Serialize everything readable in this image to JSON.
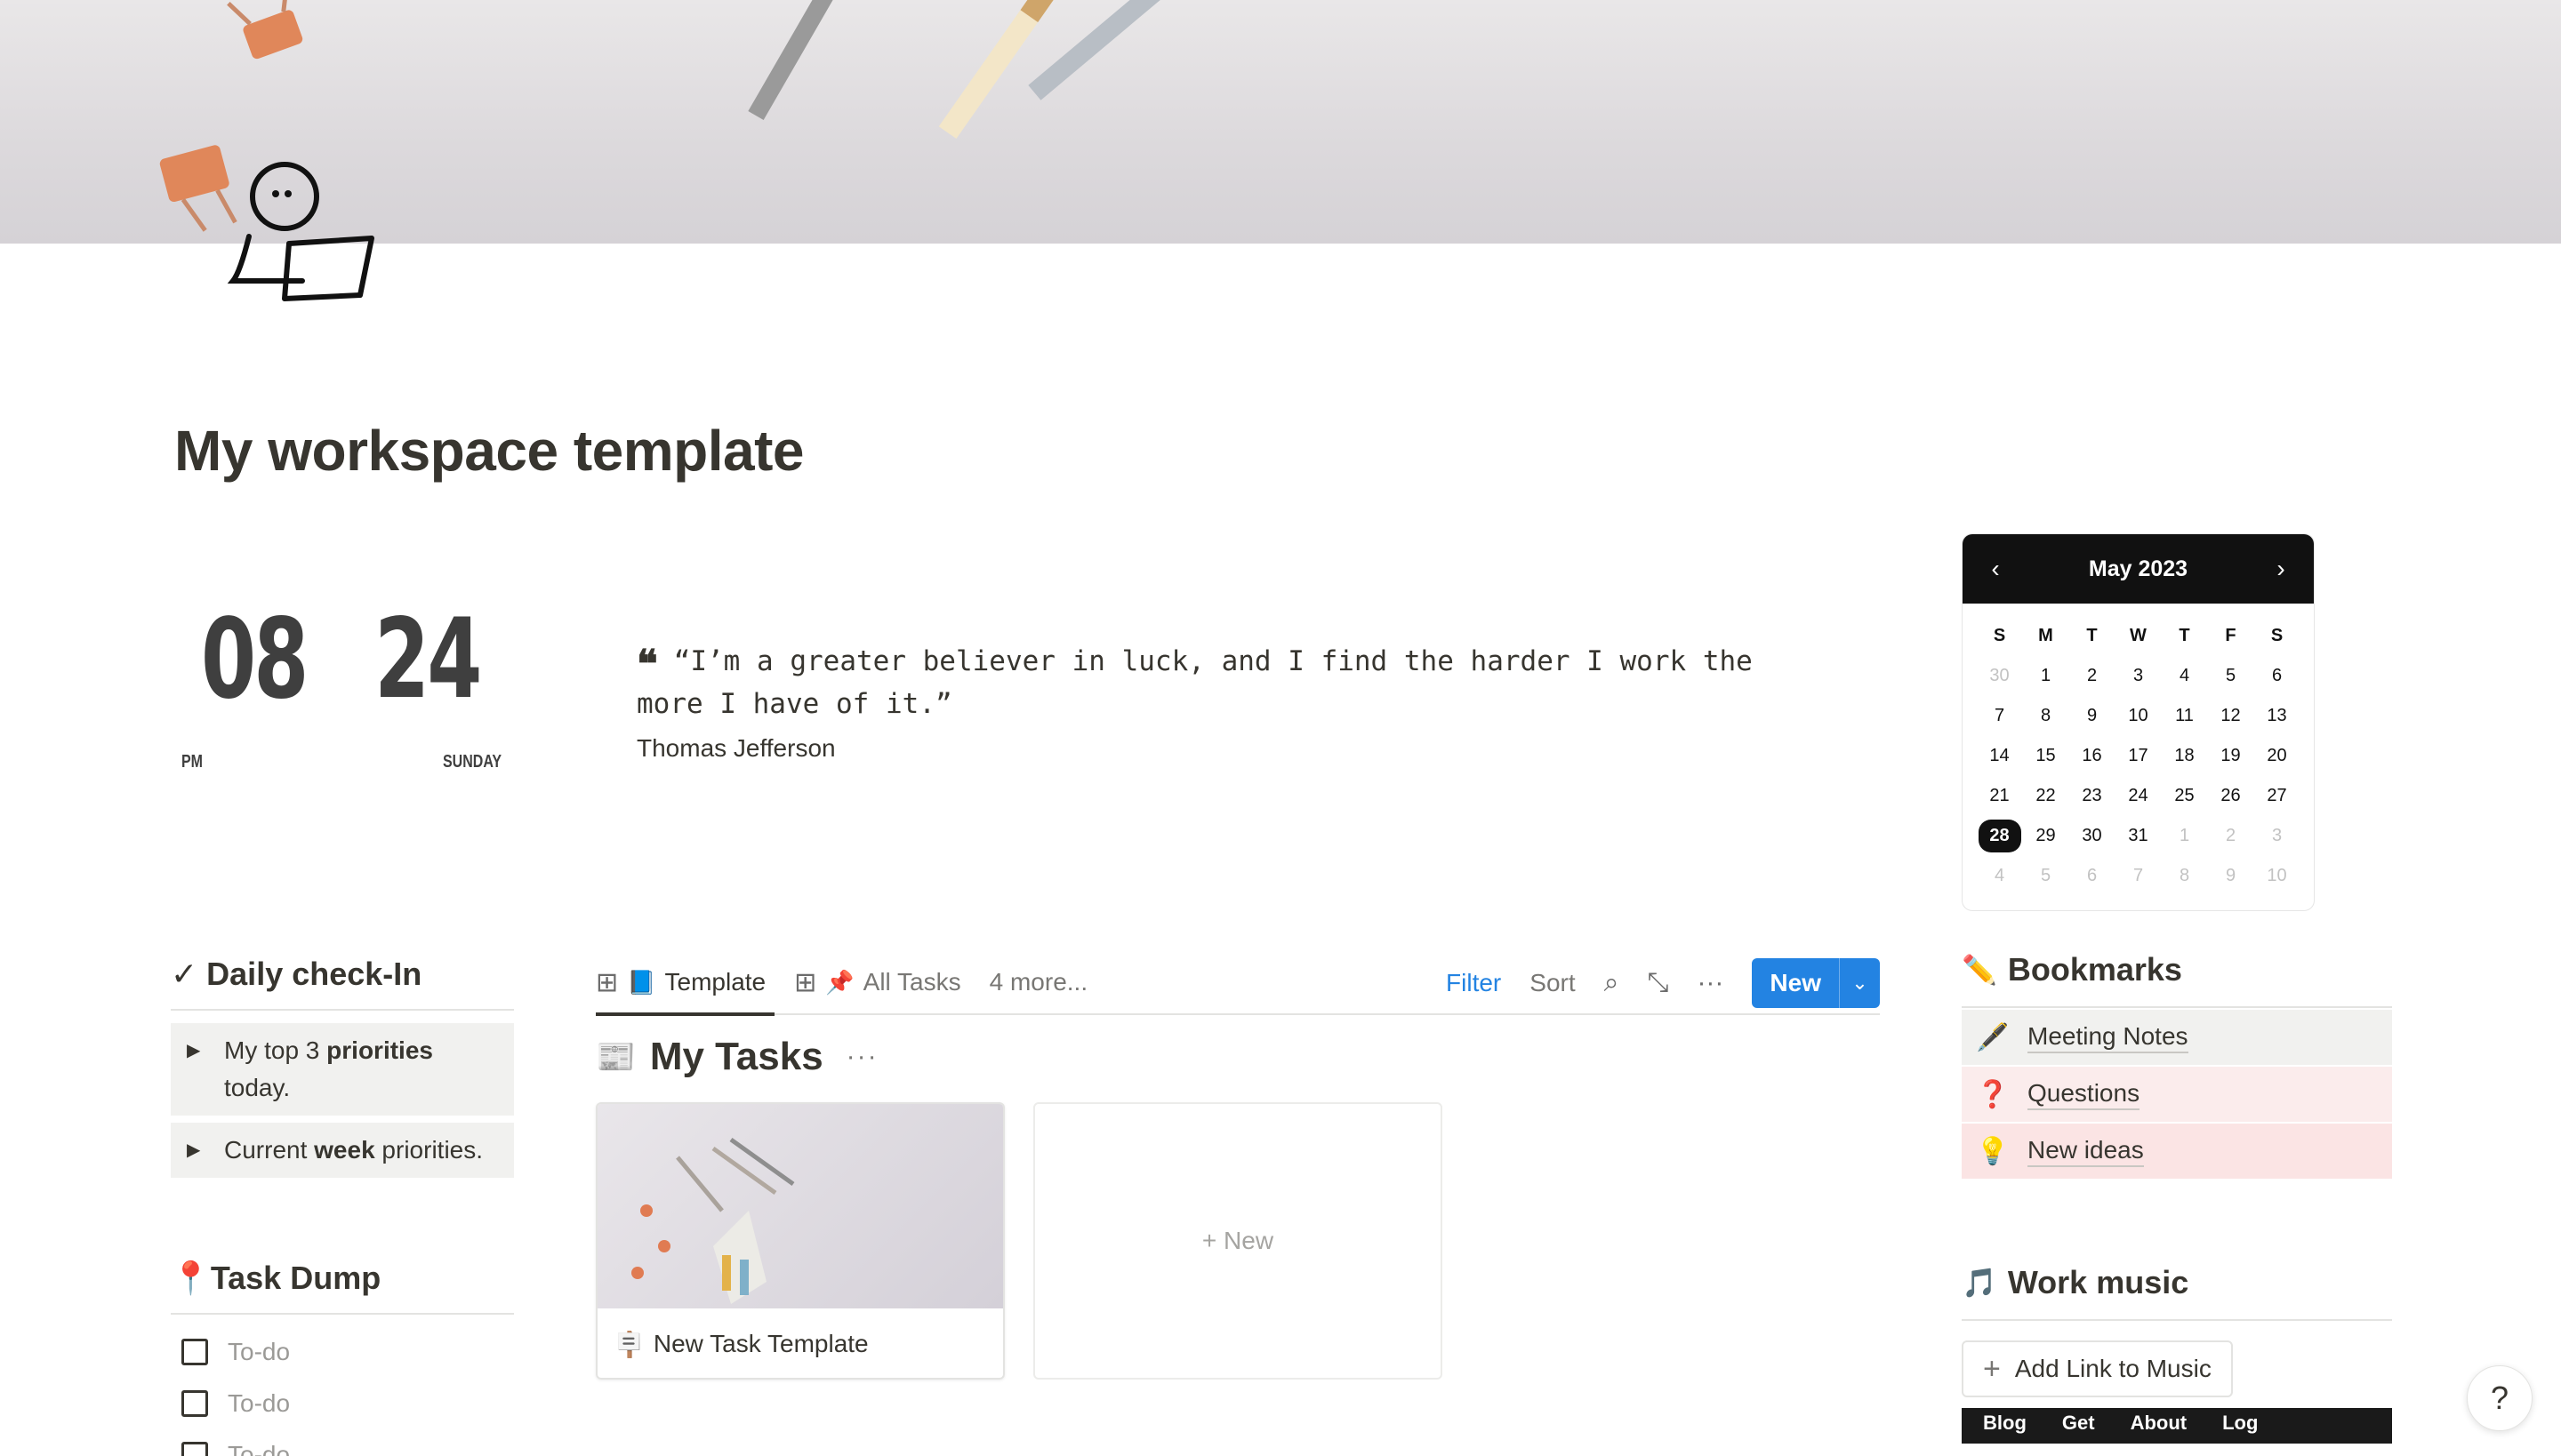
{
  "page": {
    "title": "My workspace template"
  },
  "clock": {
    "hours": "08",
    "minutes": "24",
    "ampm": "PM",
    "day": "SUNDAY"
  },
  "quote": {
    "mark": "❝",
    "text": "“I’m a greater believer in luck, and I find the harder I work the more I have of it.”",
    "author": "Thomas Jefferson"
  },
  "calendar": {
    "month_label": "May 2023",
    "prev": "‹",
    "next": "›",
    "weekdays": [
      "S",
      "M",
      "T",
      "W",
      "T",
      "F",
      "S"
    ],
    "weeks": [
      [
        "30",
        "1",
        "2",
        "3",
        "4",
        "5",
        "6"
      ],
      [
        "7",
        "8",
        "9",
        "10",
        "11",
        "12",
        "13"
      ],
      [
        "14",
        "15",
        "16",
        "17",
        "18",
        "19",
        "20"
      ],
      [
        "21",
        "22",
        "23",
        "24",
        "25",
        "26",
        "27"
      ],
      [
        "28",
        "29",
        "30",
        "31",
        "1",
        "2",
        "3"
      ],
      [
        "4",
        "5",
        "6",
        "7",
        "8",
        "9",
        "10"
      ]
    ],
    "today": "28"
  },
  "daily_checkin": {
    "heading": "✓ Daily check-In",
    "toggles": [
      {
        "pre": "My top 3 ",
        "bold": "priorities",
        "post": " today."
      },
      {
        "pre": "Current ",
        "bold": "week",
        "post": " priorities."
      }
    ]
  },
  "task_dump": {
    "heading": "📍Task Dump",
    "items": [
      "To-do",
      "To-do",
      "To-do"
    ]
  },
  "database": {
    "tabs": [
      {
        "icon": "gallery-icon",
        "emoji": "📘",
        "label": "Template",
        "active": true
      },
      {
        "icon": "gallery-icon",
        "emoji": "📌",
        "label": "All Tasks",
        "active": false
      }
    ],
    "more_views": "4 more...",
    "toolbar": {
      "filter": "Filter",
      "sort": "Sort",
      "search_icon": "search-icon",
      "expand_icon": "expand-icon",
      "more_icon": "more-icon",
      "new_label": "New"
    },
    "title": "My Tasks",
    "title_more": "···",
    "cards": [
      {
        "name": "New Task Template"
      }
    ],
    "new_card_label": "+ New"
  },
  "bookmarks": {
    "heading": "Bookmarks",
    "heading_icon": "✏️",
    "items": [
      {
        "emoji": "🖋️",
        "label": "Meeting Notes"
      },
      {
        "emoji": "❓",
        "label": "Questions"
      },
      {
        "emoji": "💡",
        "label": "New ideas"
      }
    ]
  },
  "work_music": {
    "heading": "Work music",
    "heading_icon": "🎵",
    "add_link": "Add Link to Music",
    "embed_links": [
      "Blog",
      "Get",
      "About",
      "Log"
    ]
  },
  "help": {
    "label": "?"
  },
  "colors": {
    "accent": "#2383e2",
    "text": "#37352f",
    "calendar_header": "#111111"
  }
}
